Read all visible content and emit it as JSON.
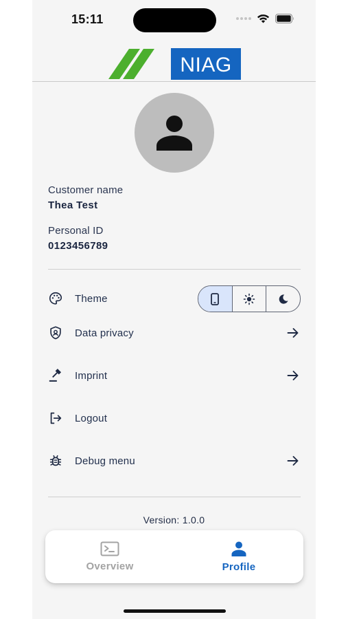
{
  "status_bar": {
    "time": "15:11"
  },
  "header": {
    "logo_text": "NIAG"
  },
  "profile": {
    "customer_name_label": "Customer name",
    "customer_name_value": "Thea Test",
    "personal_id_label": "Personal ID",
    "personal_id_value": "0123456789"
  },
  "menu": {
    "theme_label": "Theme",
    "theme_options": [
      "device",
      "light",
      "dark"
    ],
    "theme_selected": "device",
    "items": [
      {
        "label": "Data privacy",
        "icon": "shield-icon",
        "arrow": true
      },
      {
        "label": "Imprint",
        "icon": "gavel-icon",
        "arrow": true
      },
      {
        "label": "Logout",
        "icon": "logout-icon",
        "arrow": false
      },
      {
        "label": "Debug menu",
        "icon": "bug-icon",
        "arrow": true
      }
    ]
  },
  "version_text": "Version: 1.0.0",
  "bottom_nav": {
    "items": [
      {
        "label": "Overview",
        "icon": "terminal-icon",
        "active": false
      },
      {
        "label": "Profile",
        "icon": "person-icon",
        "active": true
      }
    ]
  },
  "colors": {
    "accent": "#1565c0",
    "brand_blue": "#1565c0",
    "brand_green": "#4caf2e",
    "text_dark": "#1f2a44",
    "inactive": "#a3a3a3",
    "selected_segment": "#d9e5fb"
  }
}
